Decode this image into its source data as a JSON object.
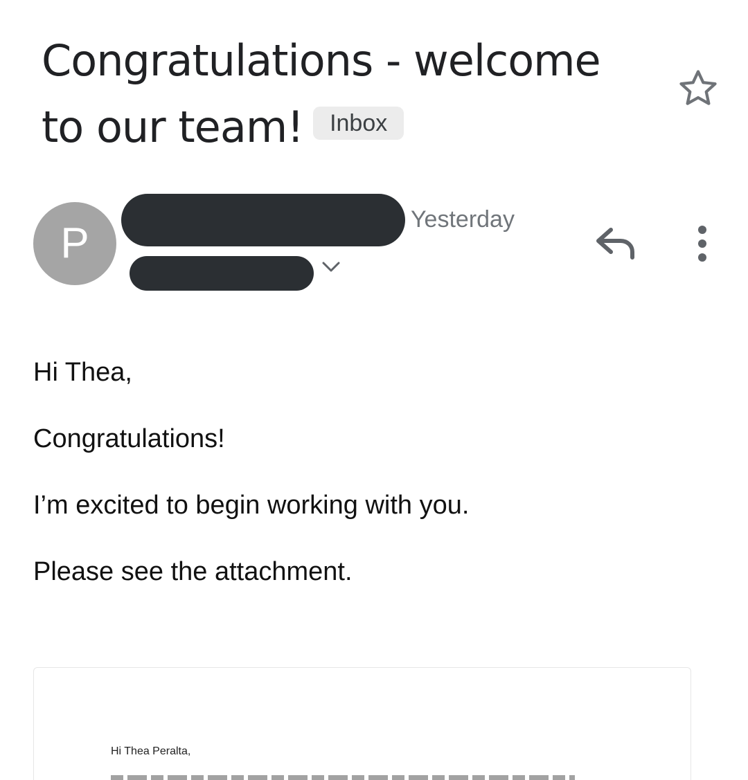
{
  "email": {
    "subject": "Congratulations - welcome to our team!",
    "label": "Inbox",
    "sender_initial": "P",
    "timestamp": "Yesterday",
    "body_paragraphs": [
      "Hi Thea,",
      "Congratulations!",
      "I’m excited to begin working with you.",
      "Please see the attachment."
    ]
  },
  "attachment": {
    "greeting": "Hi Thea Peralta,"
  },
  "icons": {
    "star": "star-outline-icon",
    "reply": "reply-icon",
    "more": "more-vertical-icon",
    "expand": "chevron-down-icon"
  },
  "colors": {
    "avatar_bg": "#a5a5a5",
    "label_bg": "#ececec",
    "redaction": "#2b2f33",
    "muted_text": "#70757a",
    "icon": "#5f6368"
  }
}
